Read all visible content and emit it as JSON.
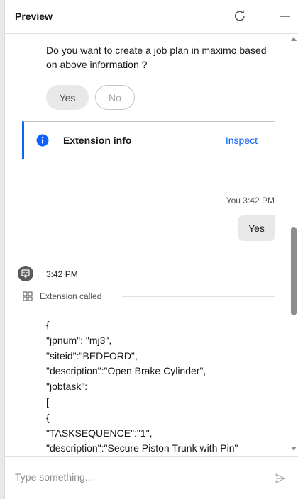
{
  "header": {
    "title": "Preview"
  },
  "chat": {
    "question": "Do you want to create a job plan in maximo based on above information ?",
    "options": [
      {
        "label": "Yes",
        "selected": true
      },
      {
        "label": "No",
        "selected": false
      }
    ],
    "extension_card": {
      "label": "Extension info",
      "action": "Inspect"
    },
    "user_message": {
      "meta": "You 3:42 PM",
      "text": "Yes"
    },
    "bot_message": {
      "time": "3:42 PM",
      "extension_called": "Extension called",
      "json_lines": [
        "{",
        "\"jpnum\": \"mj3\",",
        "\"siteid\":\"BEDFORD\",",
        "\"description\":\"Open Brake Cylinder\",",
        "\"jobtask\":",
        "[",
        "{",
        "\"TASKSEQUENCE\":\"1\",",
        "\"description\":\"Secure Piston Trunk with Pin\""
      ]
    }
  },
  "composer": {
    "placeholder": "Type something..."
  },
  "colors": {
    "accent": "#0f62fe",
    "bubble": "#e8e8e8",
    "border": "#c6c6c6",
    "avatar": "#5a5a5a"
  },
  "icons": {
    "refresh": "refresh-icon",
    "minimize": "minimize-icon",
    "info": "info-icon",
    "bot": "chat-bot-icon",
    "extension": "extension-icon",
    "send": "send-icon"
  }
}
